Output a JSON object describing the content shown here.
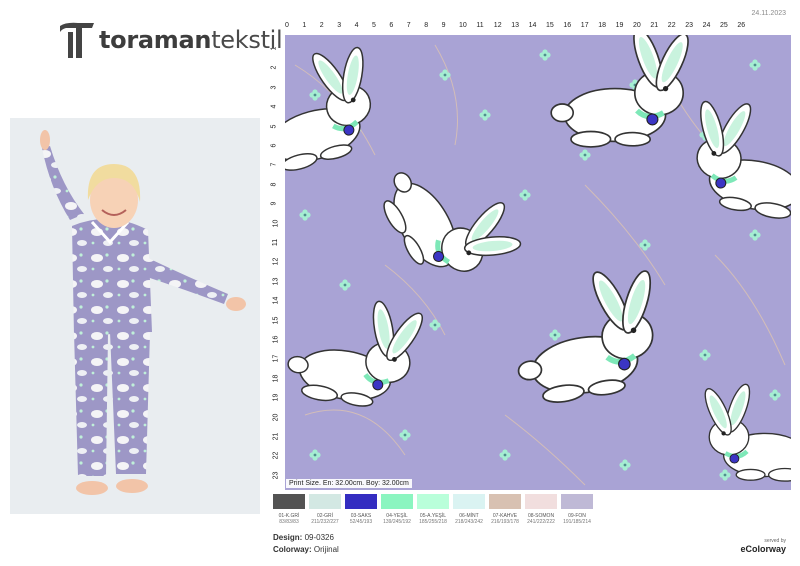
{
  "brand": {
    "name_bold": "toraman",
    "name_light": "tekstil",
    "logo_icon": "toraman-logo-icon"
  },
  "date": "24.11.2023",
  "ruler": {
    "top": [
      "0",
      "1",
      "2",
      "3",
      "4",
      "5",
      "6",
      "7",
      "8",
      "9",
      "10",
      "11",
      "12",
      "13",
      "14",
      "15",
      "16",
      "17",
      "18",
      "19",
      "20",
      "21",
      "22",
      "23",
      "24",
      "25",
      "26"
    ],
    "left": [
      "1",
      "2",
      "3",
      "4",
      "5",
      "6",
      "7",
      "8",
      "9",
      "10",
      "11",
      "12",
      "13",
      "14",
      "15",
      "16",
      "17",
      "18",
      "19",
      "20",
      "21",
      "22",
      "23"
    ]
  },
  "print_size": "Print Size. En: 32.00cm. Boy: 32.00cm",
  "colors": [
    {
      "name": "01-K.GRİ",
      "rgb": "83/83/83",
      "hex": "#535353"
    },
    {
      "name": "02-GRİ",
      "rgb": "211/232/227",
      "hex": "#d3e8e3"
    },
    {
      "name": "03-SAKS",
      "rgb": "52/45/193",
      "hex": "#342dc1"
    },
    {
      "name": "04-YEŞİL",
      "rgb": "139/245/192",
      "hex": "#8bf5c0"
    },
    {
      "name": "05-A.YEŞİL",
      "rgb": "185/255/218",
      "hex": "#b9ffda"
    },
    {
      "name": "06-MİNT",
      "rgb": "218/243/242",
      "hex": "#daf3f2"
    },
    {
      "name": "07-KAHVE",
      "rgb": "216/193/178",
      "hex": "#d8c1b2"
    },
    {
      "name": "08-SOMON",
      "rgb": "241/222/222",
      "hex": "#f1dede"
    },
    {
      "name": "09-FON",
      "rgb": "191/185/214",
      "hex": "#bfb9d6"
    }
  ],
  "design": {
    "label": "Design:",
    "value": "09-0326"
  },
  "colorway": {
    "label": "Colorway:",
    "value": "Orijinal"
  },
  "served": {
    "line1": "served by",
    "line2": "eColorway"
  }
}
